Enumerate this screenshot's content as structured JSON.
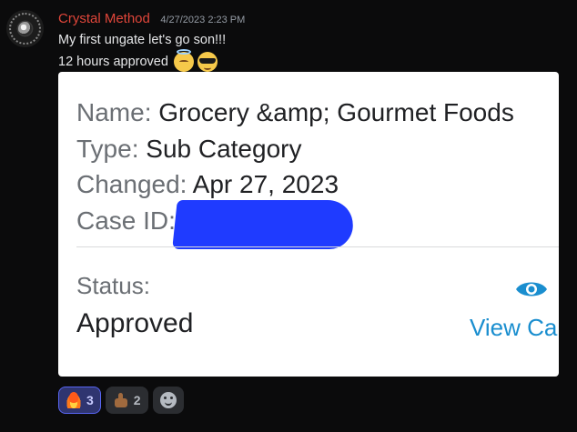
{
  "message": {
    "username": "Crystal Method",
    "timestamp": "4/27/2023 2:23 PM",
    "line1": "My first ungate let's go son!!!",
    "line2": "12 hours approved",
    "emojis": [
      "angel-face-emoji",
      "sunglasses-face-emoji"
    ]
  },
  "attachment": {
    "name_label": "Name:",
    "name_value": " Grocery &amp; Gourmet Foods",
    "type_label": "Type:",
    "type_value": " Sub Category",
    "changed_label": "Changed:",
    "changed_value": " Apr 27, 2023",
    "case_label": "Case ID:",
    "status_label": "Status:",
    "status_value": "Approved",
    "view_link": "View Ca",
    "colors": {
      "redaction": "#1f3bff",
      "link": "#1a8ecf"
    }
  },
  "reactions": [
    {
      "emoji": "fire-emoji",
      "count": "3",
      "active": true
    },
    {
      "emoji": "thumbs-up-emoji",
      "count": "2",
      "active": false
    }
  ],
  "colors": {
    "username": "#e0463a",
    "background": "#0b0b0c",
    "reaction_active": "#5865f2"
  }
}
